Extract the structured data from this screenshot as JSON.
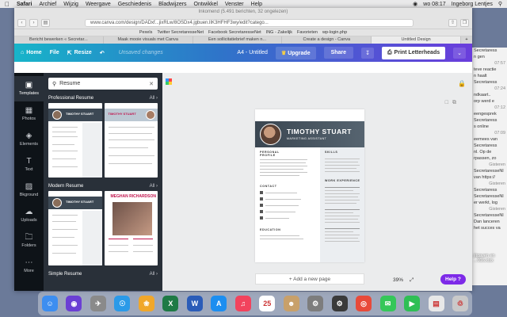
{
  "menubar": {
    "apple": "",
    "app": "Safari",
    "items": [
      "Archief",
      "Wijzig",
      "Weergave",
      "Geschiedenis",
      "Bladwijzers",
      "Ontwikkel",
      "Venster",
      "Help"
    ],
    "clock": "wo 08:17",
    "user": "Ingeborg Lentjes"
  },
  "safari": {
    "window_title": "Inkomend (5.491 berichten, 32 ongelezen)",
    "url": "www.canva.com/design/DADxf...jixRLw/8OSDx4.jgbuen.lIK3HFHF3wy/edit?catego...",
    "favorites": [
      "Pexels",
      "Twitter SecretaresseNet",
      "Facebook SecretaresseNet",
      "ING - Zakelijk",
      "Favorieten",
      "wp-login.php"
    ],
    "tabs": [
      "Bericht bewerken « Secretar...",
      "Maak mooie visuals met Canva",
      "Een sollicitatiebrief maken n...",
      "Create a design - Canva",
      "Untitled Design"
    ],
    "new_tab": "+"
  },
  "canva": {
    "home": "Home",
    "file": "File",
    "resize": "Resize",
    "unsaved": "Unsaved changes",
    "doc_title": "A4 - Untitled",
    "upgrade": "Upgrade",
    "share": "Share",
    "print": "Print Letterheads",
    "nav": [
      {
        "label": "Templates",
        "icon": "templates-icon"
      },
      {
        "label": "Photos",
        "icon": "photos-icon"
      },
      {
        "label": "Elements",
        "icon": "elements-icon"
      },
      {
        "label": "Text",
        "icon": "text-icon"
      },
      {
        "label": "Bkground",
        "icon": "background-icon"
      },
      {
        "label": "Uploads",
        "icon": "uploads-icon"
      },
      {
        "label": "Folders",
        "icon": "folders-icon"
      },
      {
        "label": "More",
        "icon": "more-icon"
      }
    ],
    "search_value": "Resume",
    "sections": [
      {
        "title": "Professional Resume",
        "all": "All"
      },
      {
        "title": "Modern Resume",
        "all": "All"
      },
      {
        "title": "Simple Resume",
        "all": "All"
      }
    ],
    "thumb_names": [
      "TIMOTHY STUART",
      "MEGHAN RICHARDSON"
    ],
    "resume": {
      "name": "TIMOTHY STUART",
      "role": "MARKETING ASSISTANT",
      "h_profile": "PERSONAL PROFILE",
      "h_contact": "CONTACT",
      "h_education": "EDUCATION",
      "h_skills": "SKILLS",
      "h_work": "WORK EXPERIENCE"
    },
    "add_page": "+ Add a new page",
    "zoom": "39%",
    "help": "Help ?"
  },
  "messages": [
    {
      "text": "Secretaress",
      "time": ""
    },
    {
      "text": "n gen",
      "time": ""
    },
    {
      "text": "teve reactie",
      "time": "07:57"
    },
    {
      "text": "n haalt",
      "time": ""
    },
    {
      "text": "Secretaress",
      "time": ""
    },
    {
      "text": "ndkaart..",
      "time": "07:24"
    },
    {
      "text": "orp werd e",
      "time": ""
    },
    {
      "text": "eengesprek",
      "time": "07:12"
    },
    {
      "text": "Secretaress",
      "time": ""
    },
    {
      "text": "s online",
      "time": ""
    },
    {
      "text": "eemees van",
      "time": "07:09"
    },
    {
      "text": "Secretaress",
      "time": ""
    },
    {
      "text": "nl. Op de",
      "time": ""
    },
    {
      "text": "rpassen, zo",
      "time": ""
    },
    {
      "text": "",
      "time": "Gisteren"
    },
    {
      "text": "SecretaresseNl",
      "time": ""
    },
    {
      "text": "van https://",
      "time": ""
    },
    {
      "text": "Secretaress",
      "time": "Gisteren"
    },
    {
      "text": "SecretaresseNl",
      "time": ""
    },
    {
      "text": "er werkt, log",
      "time": ""
    },
    {
      "text": "",
      "time": "Gisteren"
    },
    {
      "text": "SecretaresseNl",
      "time": ""
    },
    {
      "text": "Dan lanceren",
      "time": ""
    },
    {
      "text": "het succes va",
      "time": ""
    }
  ],
  "desktop_file": "jitgaven en ...016.xlsx",
  "dock": [
    "finder",
    "siri",
    "launchpad",
    "safari",
    "photos",
    "excel",
    "word",
    "app-store",
    "music",
    "calendar",
    "contacts",
    "settings",
    "canva",
    "chrome",
    "messages",
    "facetime",
    "preview",
    "trash"
  ],
  "colors": {
    "brand_gradient_start": "#17b4c9",
    "brand_gradient_end": "#6a3ddc",
    "sidebar": "#0e1318",
    "panel": "#293039",
    "accent_purple": "#7d2ae8"
  }
}
